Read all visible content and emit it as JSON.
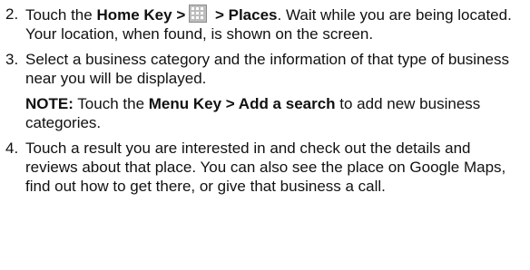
{
  "steps": [
    {
      "number": "2.",
      "paragraphs": [
        {
          "t1": "Touch the ",
          "b1": "Home Key >",
          "icon": "apps-grid-icon",
          "b2": " > Places",
          "t2": ". Wait while you are being located. Your location, when found, is shown on the screen."
        }
      ]
    },
    {
      "number": "3.",
      "paragraphs": [
        {
          "t1": "Select a business category and the information of that type of business near you will be displayed."
        },
        {
          "b1": "NOTE:",
          "t1": " Touch the ",
          "b2": "Menu Key > Add a search",
          "t2": " to add new business categories."
        }
      ]
    },
    {
      "number": "4.",
      "paragraphs": [
        {
          "t1": "Touch a result you are interested in and check out the details and reviews about that place. You can also see the place on Google Maps, find out how to get there, or give that business a call."
        }
      ]
    }
  ]
}
